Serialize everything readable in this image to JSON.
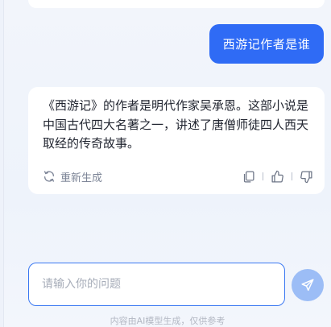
{
  "conversation": {
    "user_message": "西游记作者是谁",
    "answer": {
      "text": "《西游记》的作者是明代作家吴承恩。这部小说是中国古代四大名著之一，讲述了唐僧师徒四人西天取经的传奇故事。",
      "regenerate_label": "重新生成",
      "action_icons": [
        "copy-icon",
        "thumbs-up-icon",
        "thumbs-down-icon"
      ]
    }
  },
  "composer": {
    "placeholder": "请输入你的问题",
    "value": "",
    "send_icon": "send-icon"
  },
  "footer": {
    "disclaimer": "内容由AI模型生成，仅供参考"
  },
  "colors": {
    "accent": "#2f6bf5",
    "send_disabled": "#9cbdf6",
    "background": "#eef2fa"
  }
}
